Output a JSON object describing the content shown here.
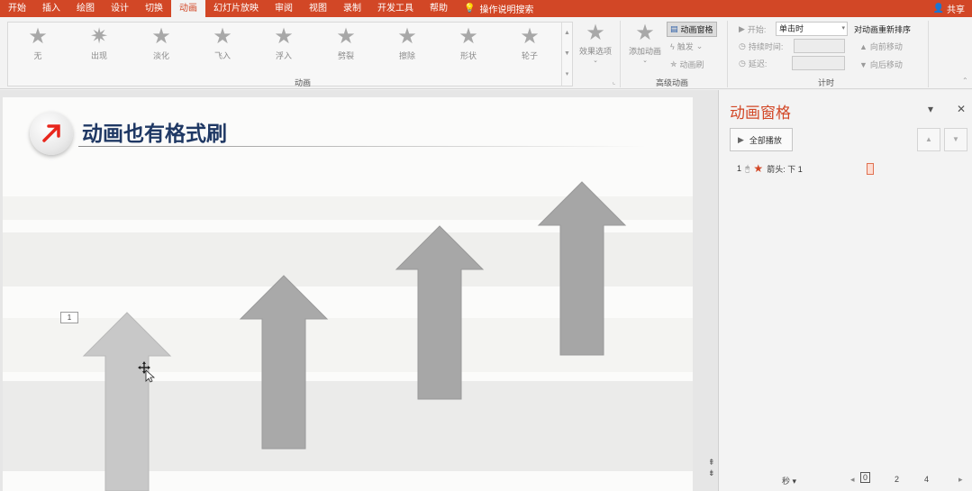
{
  "tabs": [
    "开始",
    "插入",
    "绘图",
    "设计",
    "切换",
    "动画",
    "幻灯片放映",
    "审阅",
    "视图",
    "录制",
    "开发工具",
    "帮助"
  ],
  "active_tab_index": 5,
  "tell_me": "操作说明搜索",
  "share": "共享",
  "gallery": {
    "items": [
      "无",
      "出现",
      "淡化",
      "飞入",
      "浮入",
      "劈裂",
      "擦除",
      "形状",
      "轮子"
    ],
    "effect_options": "效果选项",
    "group_label": "动画"
  },
  "advanced": {
    "add_animation": "添加动画",
    "animation_pane": "动画窗格",
    "trigger": "触发",
    "painter": "动画刷",
    "group_label": "高级动画"
  },
  "timing": {
    "start_label": "开始:",
    "start_value": "单击时",
    "duration_label": "持续时间:",
    "delay_label": "延迟:",
    "reorder_title": "对动画重新排序",
    "move_earlier": "向前移动",
    "move_later": "向后移动",
    "group_label": "计时"
  },
  "slide": {
    "title": "动画也有格式刷",
    "anim_tag": "1"
  },
  "pane": {
    "title": "动画窗格",
    "play_all": "全部播放",
    "item_number": "1",
    "item_label": "箭头: 下 1",
    "seconds": "秒",
    "timeline": [
      "0",
      "2",
      "4"
    ]
  },
  "colors": {
    "accent": "#d24726",
    "title": "#1f3864",
    "arrow": "#a6a6a6"
  }
}
